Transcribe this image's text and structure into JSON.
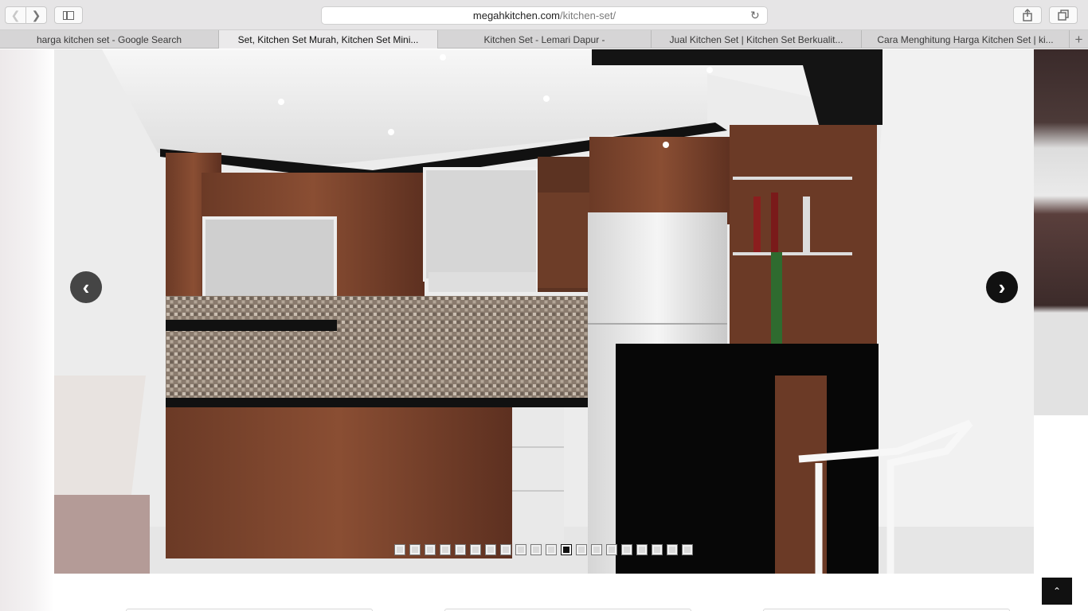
{
  "browser": {
    "url_domain": "megahkitchen.com",
    "url_path": "/kitchen-set/"
  },
  "tabs": [
    {
      "label": "harga kitchen set - Google Search",
      "active": false
    },
    {
      "label": "Set, Kitchen Set Murah, Kitchen Set Mini...",
      "active": true
    },
    {
      "label": "Kitchen Set - Lemari Dapur -",
      "active": false
    },
    {
      "label": "Jual Kitchen Set | Kitchen Set Berkualit...",
      "active": false
    },
    {
      "label": "Cara Menghitung Harga Kitchen Set | ki...",
      "active": false
    }
  ],
  "slider": {
    "slide_count": 20,
    "current_slide": 12,
    "image_subject": "kitchen-set-render"
  },
  "icons": {
    "back": "chevron-left-icon",
    "forward": "chevron-right-icon",
    "sidebar": "sidebar-icon",
    "reload": "reload-icon",
    "share": "share-icon",
    "tabs": "tabs-overview-icon",
    "new_tab": "plus-icon",
    "to_top": "chevron-up-icon"
  }
}
